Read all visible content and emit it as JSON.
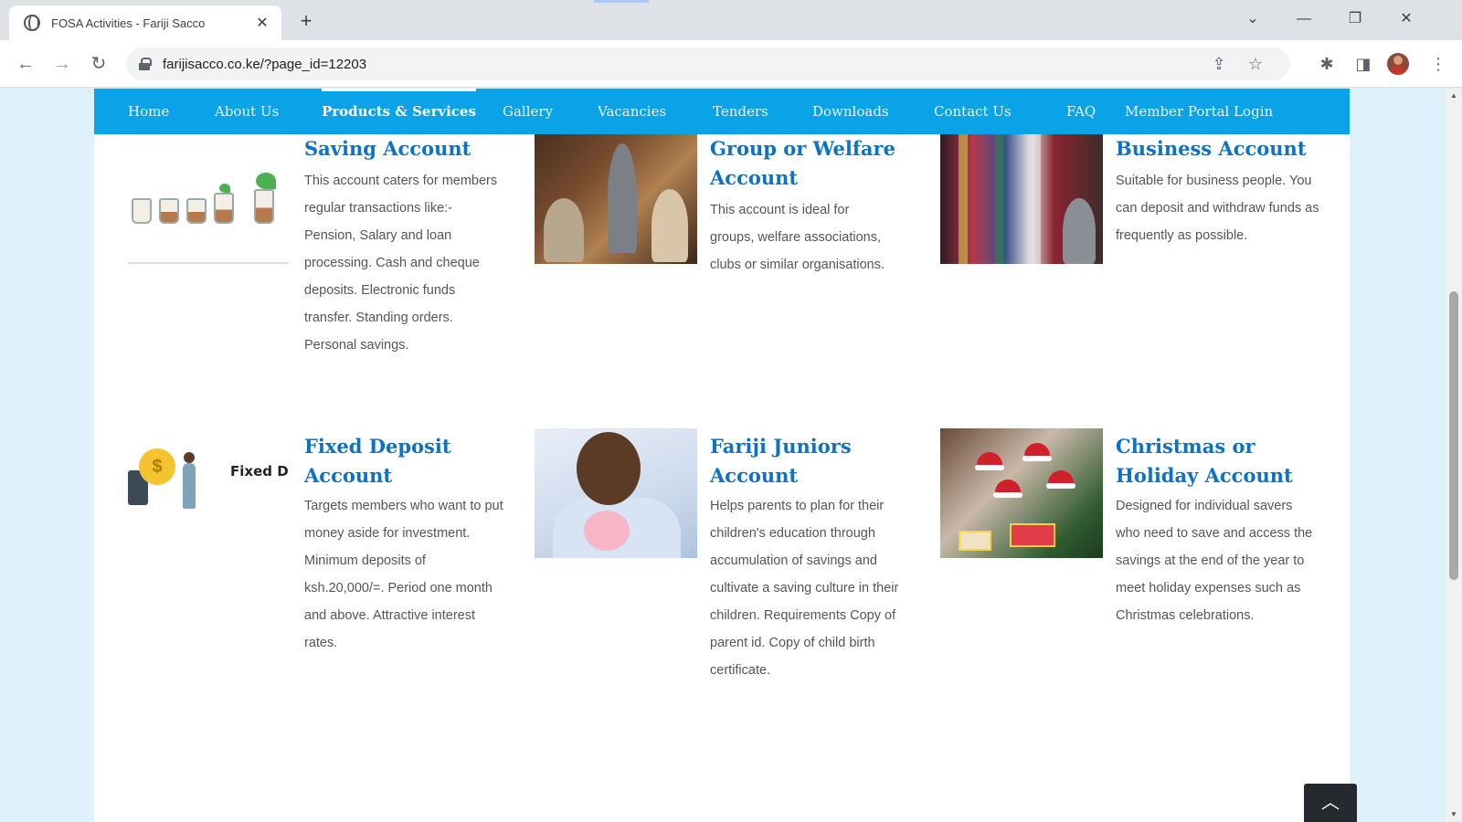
{
  "browser": {
    "tab_title": "FOSA Activities - Fariji Sacco",
    "tab_close": "✕",
    "new_tab": "+",
    "url": "farijisacco.co.ke/?page_id=12203",
    "controls": {
      "chevron": "⌄",
      "minimize": "—",
      "restore": "❐",
      "close": "✕"
    }
  },
  "site_nav": {
    "items": [
      "Home",
      "About Us",
      "Products & Services",
      "Gallery",
      "Vacancies",
      "Tenders",
      "Downloads",
      "Contact Us",
      "FAQ",
      "Member Portal Login"
    ],
    "active_index": 2
  },
  "cards": [
    {
      "title": "Saving Account",
      "description": "This account caters for members regular transactions like:- Pension, Salary and loan processing. Cash and cheque deposits. Electronic funds transfer. Standing orders. Personal savings."
    },
    {
      "title": "Group or Welfare Account",
      "description": "This account is ideal for groups, welfare associations, clubs or similar organisations."
    },
    {
      "title": "Business Account",
      "description": "Suitable for business people. You can deposit and withdraw funds as frequently as possible."
    },
    {
      "title": "Fixed Deposit Account",
      "description": "Targets members who want to put money aside for investment. Minimum deposits of ksh.20,000/=. Period one month and above. Attractive interest rates.",
      "image_text": "Fixed Deposit Account",
      "coin_symbol": "$"
    },
    {
      "title": "Fariji Juniors Account",
      "description": "Helps parents to plan for their children's education through accumulation of savings and cultivate a saving culture in their children. Requirements Copy of parent id. Copy of child birth certificate."
    },
    {
      "title": "Christmas or Holiday Account",
      "description": "Designed for individual savers who need to save and access the savings at the end of the year to meet holiday expenses such as Christmas celebrations."
    }
  ],
  "back_to_top": "︿",
  "colors": {
    "nav_bg": "#0aa3e8",
    "title": "#0b72c6",
    "page_bg": "#dff1fc"
  }
}
